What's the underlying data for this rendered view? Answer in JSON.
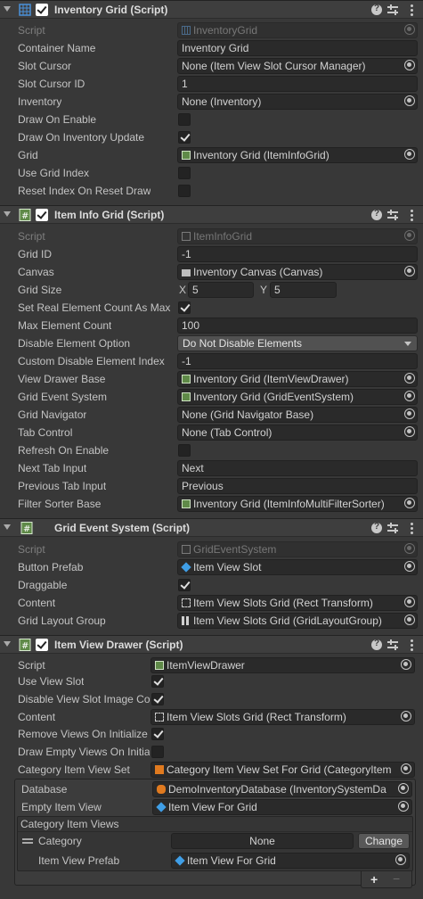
{
  "components": [
    {
      "title": "Inventory Grid (Script)",
      "icon": "grid-component-icon",
      "enabled": true,
      "fields": [
        {
          "label": "Script",
          "value": "InventoryGrid",
          "icon": "grid-component-icon",
          "kind": "object",
          "disabled": true
        },
        {
          "label": "Container Name",
          "value": "Inventory Grid",
          "kind": "text"
        },
        {
          "label": "Slot Cursor",
          "value": "None (Item View Slot Cursor Manager)",
          "kind": "object"
        },
        {
          "label": "Slot Cursor ID",
          "value": "1",
          "kind": "text"
        },
        {
          "label": "Inventory",
          "value": "None (Inventory)",
          "kind": "object"
        },
        {
          "label": "Draw On Enable",
          "checked": false,
          "kind": "bool"
        },
        {
          "label": "Draw On Inventory Update",
          "checked": true,
          "kind": "bool"
        },
        {
          "label": "Grid",
          "value": "Inventory Grid (ItemInfoGrid)",
          "icon": "script-icon",
          "kind": "object"
        },
        {
          "label": "Use Grid Index",
          "checked": false,
          "kind": "bool"
        },
        {
          "label": "Reset Index On Reset Draw",
          "checked": false,
          "kind": "bool"
        }
      ]
    },
    {
      "title": "Item Info Grid (Script)",
      "icon": "script-icon",
      "enabled": true,
      "fields": [
        {
          "label": "Script",
          "value": "ItemInfoGrid",
          "icon": "script-icon",
          "kind": "object",
          "disabled": true
        },
        {
          "label": "Grid ID",
          "value": "-1",
          "kind": "text"
        },
        {
          "label": "Canvas",
          "value": "Inventory Canvas (Canvas)",
          "icon": "canvas-icon",
          "kind": "object"
        },
        {
          "label": "Grid Size",
          "kind": "vector",
          "x_label": "X",
          "x": "5",
          "y_label": "Y",
          "y": "5"
        },
        {
          "label": "Set Real Element Count As Max",
          "checked": true,
          "kind": "bool"
        },
        {
          "label": "Max Element Count",
          "value": "100",
          "kind": "text"
        },
        {
          "label": "Disable Element Option",
          "value": "Do Not Disable Elements",
          "kind": "enum"
        },
        {
          "label": "Custom Disable Element Index",
          "value": "-1",
          "kind": "text"
        },
        {
          "label": "View Drawer Base",
          "value": "Inventory Grid (ItemViewDrawer)",
          "icon": "script-icon",
          "kind": "object"
        },
        {
          "label": "Grid Event System",
          "value": "Inventory Grid (GridEventSystem)",
          "icon": "script-icon",
          "kind": "object"
        },
        {
          "label": "Grid Navigator",
          "value": "None (Grid Navigator Base)",
          "kind": "object"
        },
        {
          "label": "Tab Control",
          "value": "None (Tab Control)",
          "kind": "object"
        },
        {
          "label": "Refresh On Enable",
          "checked": false,
          "kind": "bool"
        },
        {
          "label": "Next Tab Input",
          "value": "Next",
          "kind": "text"
        },
        {
          "label": "Previous Tab Input",
          "value": "Previous",
          "kind": "text"
        },
        {
          "label": "Filter Sorter Base",
          "value": "Inventory Grid (ItemInfoMultiFilterSorter)",
          "icon": "script-icon",
          "kind": "object"
        }
      ]
    },
    {
      "title": "Grid Event System (Script)",
      "icon": "script-icon",
      "enabled": null,
      "fields": [
        {
          "label": "Script",
          "value": "GridEventSystem",
          "icon": "script-icon",
          "kind": "object",
          "disabled": true
        },
        {
          "label": "Button Prefab",
          "value": "Item View Slot",
          "icon": "prefab-cube-icon",
          "kind": "object"
        },
        {
          "label": "Draggable",
          "checked": true,
          "kind": "bool"
        },
        {
          "label": "Content",
          "value": "Item View Slots Grid (Rect Transform)",
          "icon": "rect-transform-icon",
          "kind": "object"
        },
        {
          "label": "Grid Layout Group",
          "value": "Item View Slots Grid (GridLayoutGroup)",
          "icon": "grid-layout-icon",
          "kind": "object"
        }
      ]
    },
    {
      "title": "Item View Drawer (Script)",
      "icon": "script-icon",
      "enabled": true,
      "fields": [
        {
          "label": "Script",
          "value": "ItemViewDrawer",
          "icon": "script-icon",
          "kind": "object"
        },
        {
          "label": "Use View Slot",
          "checked": true,
          "kind": "bool"
        },
        {
          "label": "Disable View Slot Image Co",
          "checked": true,
          "kind": "bool"
        },
        {
          "label": "Content",
          "value": "Item View Slots Grid (Rect Transform)",
          "icon": "rect-transform-icon",
          "kind": "object"
        },
        {
          "label": "Remove Views On Initialize",
          "checked": true,
          "kind": "bool"
        },
        {
          "label": "Draw Empty Views On Initia",
          "checked": false,
          "kind": "bool"
        },
        {
          "label": "Category Item View Set",
          "value": "Category Item View Set For Grid (CategoryItem",
          "icon": "view-set-icon",
          "kind": "object"
        }
      ],
      "nested": {
        "database_label": "Database",
        "database_value": "DemoInventoryDatabase (InventorySystemDa",
        "empty_view_label": "Empty Item View",
        "empty_view_value": "Item View For Grid",
        "list_title": "Category Item Views",
        "category_label": "Category",
        "category_value": "None",
        "change_label": "Change",
        "prefab_label": "Item View Prefab",
        "prefab_value": "Item View For Grid",
        "add_label": "+",
        "remove_label": "−"
      }
    }
  ]
}
